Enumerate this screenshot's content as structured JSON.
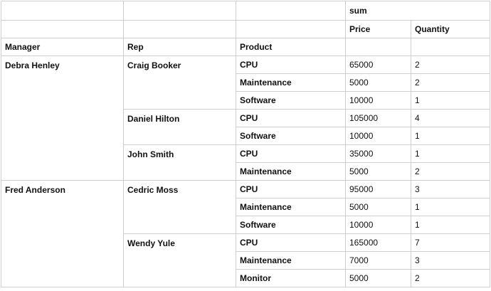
{
  "table": {
    "value_header": "sum",
    "columns": {
      "manager": "Manager",
      "rep": "Rep",
      "product": "Product",
      "price": "Price",
      "quantity": "Quantity"
    },
    "rows": [
      {
        "manager": "Debra Henley",
        "rep": "Craig Booker",
        "product": "CPU",
        "price": "65000",
        "quantity": "2"
      },
      {
        "manager": "",
        "rep": "",
        "product": "Maintenance",
        "price": "5000",
        "quantity": "2"
      },
      {
        "manager": "",
        "rep": "",
        "product": "Software",
        "price": "10000",
        "quantity": "1"
      },
      {
        "manager": "",
        "rep": "Daniel Hilton",
        "product": "CPU",
        "price": "105000",
        "quantity": "4"
      },
      {
        "manager": "",
        "rep": "",
        "product": "Software",
        "price": "10000",
        "quantity": "1"
      },
      {
        "manager": "",
        "rep": "John Smith",
        "product": "CPU",
        "price": "35000",
        "quantity": "1"
      },
      {
        "manager": "",
        "rep": "",
        "product": "Maintenance",
        "price": "5000",
        "quantity": "2"
      },
      {
        "manager": "Fred Anderson",
        "rep": "Cedric Moss",
        "product": "CPU",
        "price": "95000",
        "quantity": "3"
      },
      {
        "manager": "",
        "rep": "",
        "product": "Maintenance",
        "price": "5000",
        "quantity": "1"
      },
      {
        "manager": "",
        "rep": "",
        "product": "Software",
        "price": "10000",
        "quantity": "1"
      },
      {
        "manager": "",
        "rep": "Wendy Yule",
        "product": "CPU",
        "price": "165000",
        "quantity": "7"
      },
      {
        "manager": "",
        "rep": "",
        "product": "Maintenance",
        "price": "7000",
        "quantity": "3"
      },
      {
        "manager": "",
        "rep": "",
        "product": "Monitor",
        "price": "5000",
        "quantity": "2"
      }
    ]
  }
}
